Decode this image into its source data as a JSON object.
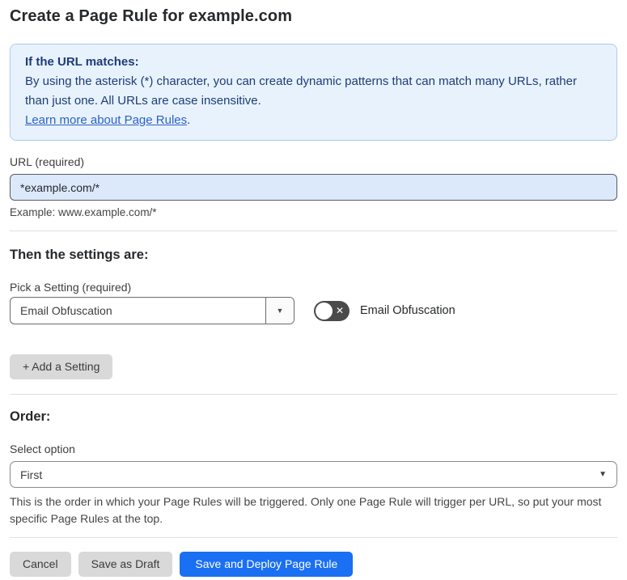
{
  "page": {
    "title": "Create a Page Rule for example.com"
  },
  "notice": {
    "heading": "If the URL matches:",
    "body": "By using the asterisk (*) character, you can create dynamic patterns that can match many URLs, rather than just one. All URLs are case insensitive.",
    "link_text": "Learn more about Page Rules",
    "link_suffix": "."
  },
  "url_field": {
    "label": "URL (required)",
    "value": "*example.com/*",
    "example": "Example: www.example.com/*"
  },
  "settings": {
    "heading": "Then the settings are:",
    "picker_label": "Pick a Setting (required)",
    "selected_setting": "Email Obfuscation",
    "dropdown_arrow": "▼",
    "toggle_state": "off",
    "toggle_glyph": "✕",
    "toggle_label": "Email Obfuscation",
    "add_button_label": "+ Add a Setting"
  },
  "order": {
    "heading": "Order:",
    "label": "Select option",
    "selected_option": "First",
    "chevron": "▼",
    "help": "This is the order in which your Page Rules will be triggered. Only one Page Rule will trigger per URL, so put your most specific Page Rules at the top."
  },
  "actions": {
    "cancel_label": "Cancel",
    "save_draft_label": "Save as Draft",
    "save_deploy_label": "Save and Deploy Page Rule"
  },
  "colors": {
    "accent_blue": "#1a6ff2",
    "notice_bg": "#e8f2fc",
    "notice_border": "#abccee",
    "notice_text": "#1d3d78",
    "link_blue": "#2b62c4",
    "input_bg": "#dce9fa",
    "toggle_track": "#4a4a4a",
    "button_gray": "#d9d9d9"
  }
}
